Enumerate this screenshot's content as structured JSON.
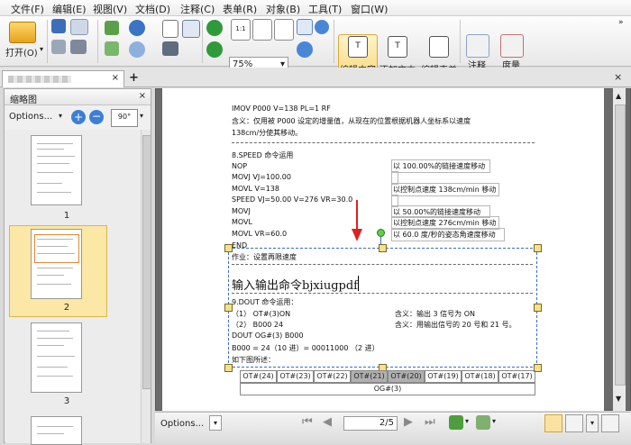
{
  "menu": {
    "file": "文件(F)",
    "edit": "编辑(E)",
    "view": "视图(V)",
    "document": "文档(D)",
    "annotate": "注释(C)",
    "form": "表单(R)",
    "object": "对象(B)",
    "tools": "工具(T)",
    "window": "窗口(W)"
  },
  "toolbar": {
    "open_label": "打开(O)",
    "zoom_value": "75%",
    "edit_content_label": "编辑内容",
    "add_text_label": "添加文本",
    "edit_form_label": "编辑表单",
    "comment_label": "注释",
    "measure_label": "度量"
  },
  "sidebar": {
    "title": "缩略图",
    "options_label": "Options...",
    "rotate_label": "90°",
    "thumbnails": [
      {
        "number": "1"
      },
      {
        "number": "2",
        "selected": true
      },
      {
        "number": "3"
      }
    ]
  },
  "document": {
    "lines_top": [
      "IMOV P000 V=138 PL=1 RF",
      "含义：仅用被 P000 设定的增量值，从现在的位置根据机器人坐标系以速度",
      "138cm/分使其移动。"
    ],
    "section_title": "8.SPEED 命令运用",
    "code_lines": [
      "NOP",
      "MOVJ VJ=100.00",
      "MOVL V=138",
      "SPEED VJ=50.00 V=276 VR=30.0",
      "MOVJ",
      "MOVL",
      "MOVL VR=60.0",
      "END"
    ],
    "right_notes": [
      "以 100.00%的链接速度移动",
      "",
      "以控制点速度 138cm/min 移动",
      "",
      "以 50.00%的链接速度移动",
      "以控制点速度 276cm/min 移动",
      "以 60.0 度/秒的姿态角速度移动"
    ],
    "homework": "作业：设置再限速度",
    "edit_text": "输入输出命令bjxiugpdf",
    "dout_title": "9.DOUT 命令运用：",
    "dout_line1_left": "（1）  OT#(3)ON",
    "dout_line1_right": "含义：输出 3 信号为 ON",
    "dout_line2_left": "（2）  B000 24",
    "dout_line2_right": "含义：用输出信号的 20 号和 21 号。",
    "dout_line3": "DOUT OG#(3) B000",
    "dout_line4": "B000 = 24（10 进）= 00011000 （2 进）",
    "dout_line5": "如下图所述：",
    "table_cells": [
      "OT#(24)",
      "OT#(23)",
      "OT#(22)",
      "OT#(21)",
      "OT#(20)",
      "OT#(19)",
      "OT#(18)",
      "OT#(17)"
    ],
    "table_footer": "OG#(3)"
  },
  "navigation": {
    "options_label": "Options...",
    "page_indicator": "2/5"
  },
  "colors": {
    "selection": "#3a6ad0",
    "highlight": "#f8d77a",
    "arrow": "#e02020"
  }
}
